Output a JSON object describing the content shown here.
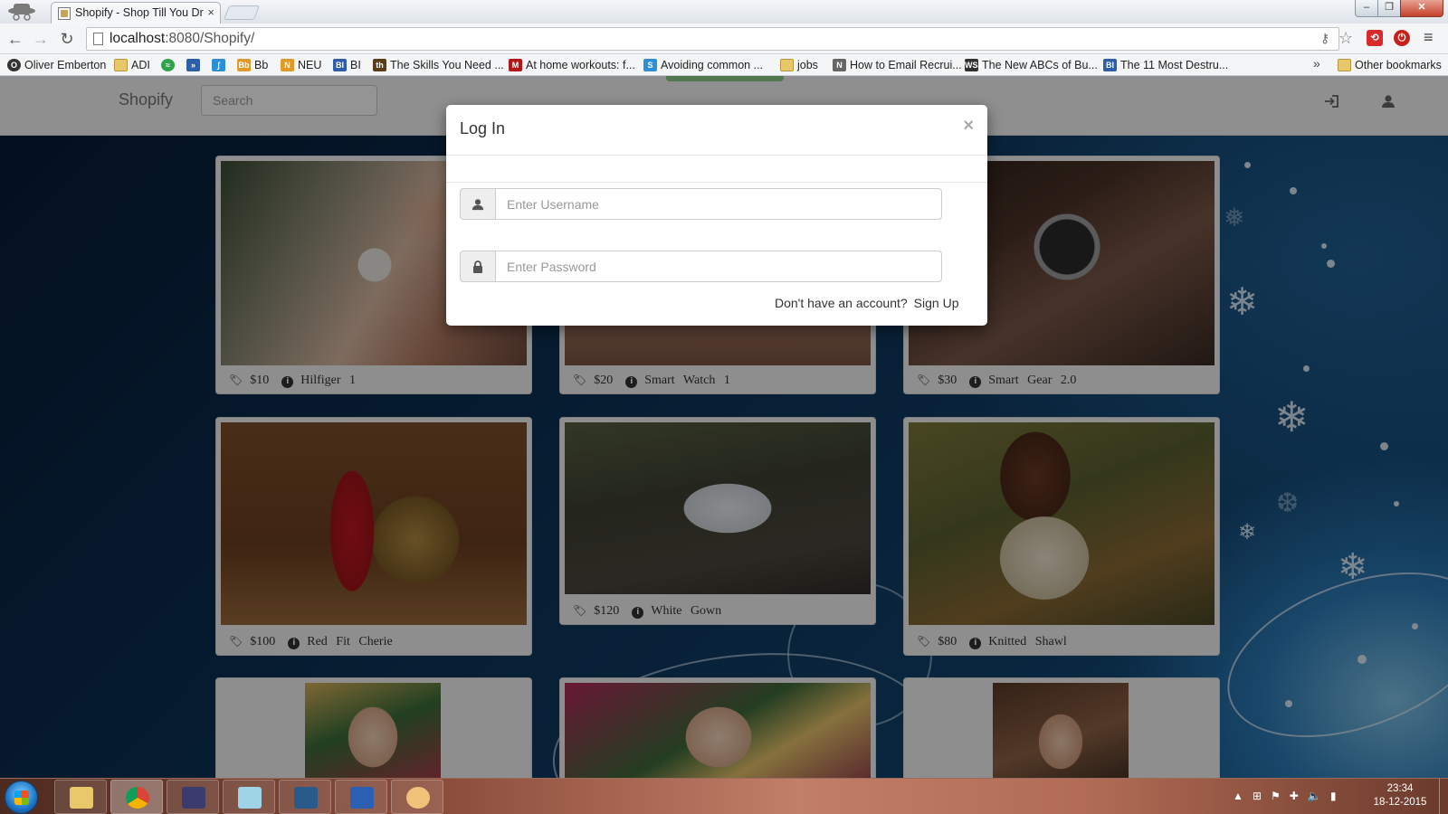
{
  "browser": {
    "tab_title": "Shopify - Shop Till You Dr",
    "tab_close": "×",
    "url_host": "localhost",
    "url_path": ":8080/Shopify/",
    "back": "←",
    "forward": "→",
    "reload": "↻",
    "menu": "≡",
    "bookmarks": [
      {
        "label": "Oliver Emberton",
        "icon": "oe-icon"
      },
      {
        "label": "ADI",
        "icon": "folder-icon"
      },
      {
        "label": "",
        "icon": "spotify-icon"
      },
      {
        "label": "",
        "icon": "double-chevron-icon"
      },
      {
        "label": "",
        "icon": "bookmark-icon"
      },
      {
        "label": "Bb",
        "icon": "bb-icon"
      },
      {
        "label": "NEU",
        "icon": "neu-icon"
      },
      {
        "label": "BI",
        "icon": "bi-icon"
      },
      {
        "label": "The Skills You Need ...",
        "icon": "skills-icon"
      },
      {
        "label": "At home workouts: f...",
        "icon": "workout-icon"
      },
      {
        "label": "Avoiding common ...",
        "icon": "avoid-icon"
      },
      {
        "label": "jobs",
        "icon": "folder-icon"
      },
      {
        "label": "How to Email Recrui...",
        "icon": "email-icon"
      },
      {
        "label": "The New ABCs of Bu...",
        "icon": "wsj-icon"
      },
      {
        "label": "The 11 Most Destru...",
        "icon": "bi-icon"
      }
    ],
    "bookmarks_overflow": "»",
    "other_bookmarks": "Other bookmarks",
    "bookmark_badges": {
      "oe": "O",
      "spotify": "≈",
      "dchev": "»",
      "bmk": "ʃ",
      "bb": "Bb",
      "neu": "N",
      "bi": "BI",
      "skills": "th",
      "workout": "M",
      "avoid": "S",
      "email": "N",
      "wsj": "WSJ",
      "bi2": "BI"
    }
  },
  "site": {
    "brand": "Shopify",
    "search_placeholder": "Search"
  },
  "products": [
    {
      "price": "$10",
      "name": "Hilfiger 1"
    },
    {
      "price": "$20",
      "name": "Smart Watch 1"
    },
    {
      "price": "$30",
      "name": "Smart Gear 2.0"
    },
    {
      "price": "$100",
      "name": "Red Fit Cherie"
    },
    {
      "price": "$120",
      "name": "White Gown"
    },
    {
      "price": "$80",
      "name": "Knitted Shawl"
    }
  ],
  "modal": {
    "title": "Log In",
    "close": "×",
    "username_placeholder": "Enter Username",
    "password_placeholder": "Enter Password",
    "no_account": "Don't have an account?",
    "signup": "Sign Up"
  },
  "taskbar": {
    "time": "23:34",
    "date": "18-12-2015",
    "apps": [
      {
        "name": "explorer-app",
        "color": "#e8c86a"
      },
      {
        "name": "chrome-app",
        "color": "#e8d9b0"
      },
      {
        "name": "eclipse-app",
        "color": "#3b3b6e"
      },
      {
        "name": "notepad-app",
        "color": "#9fd3e6"
      },
      {
        "name": "mysql-workbench-app",
        "color": "#2a5a8a"
      },
      {
        "name": "word-app",
        "color": "#2b5fb3"
      },
      {
        "name": "paint-app",
        "color": "#f0c27a"
      }
    ]
  },
  "colors": {
    "page_bg": "#0c2440",
    "navbar_bg": "#f7f7f7",
    "modal_bg": "#ffffff",
    "accent_green": "#8ecf8a"
  }
}
